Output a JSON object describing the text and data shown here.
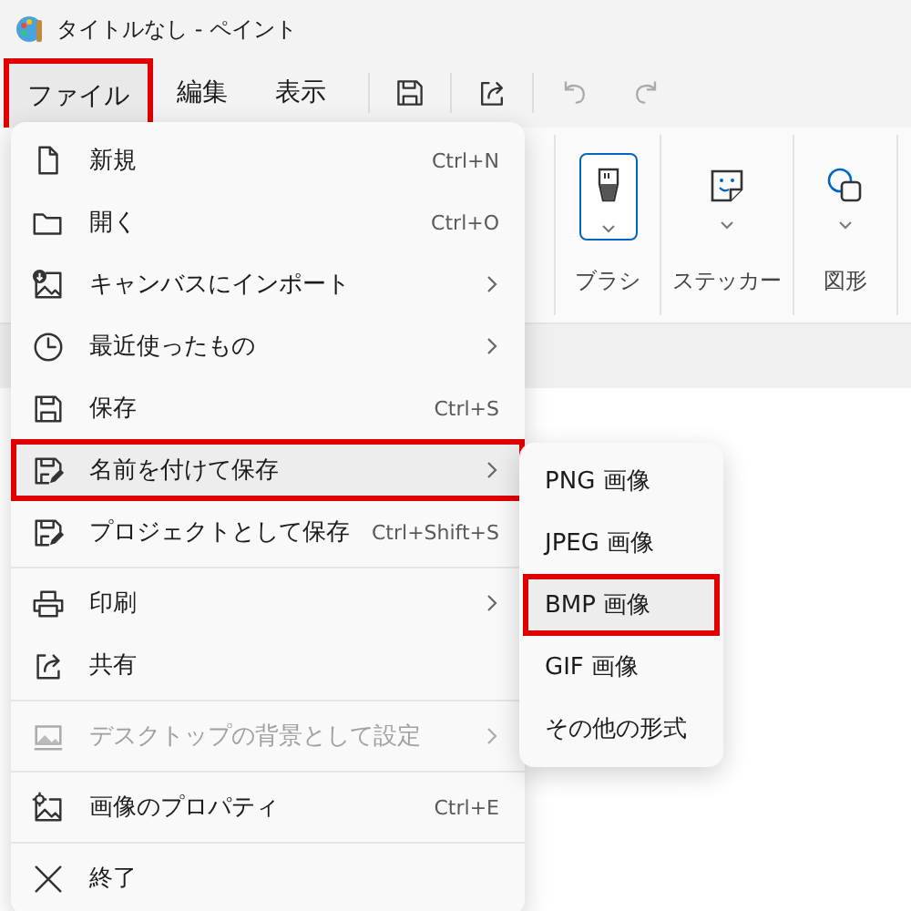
{
  "window": {
    "title": "タイトルなし - ペイント"
  },
  "menu_bar": [
    {
      "label": "ファイル",
      "selected": true
    },
    {
      "label": "編集",
      "selected": false
    },
    {
      "label": "表示",
      "selected": false
    }
  ],
  "ribbon": {
    "groups": [
      {
        "label": "ブラシ",
        "selected": true
      },
      {
        "label": "ステッカー",
        "selected": false
      },
      {
        "label": "図形",
        "selected": false
      }
    ]
  },
  "file_menu": {
    "items": [
      {
        "kind": "item",
        "label": "新規",
        "shortcut": "Ctrl+N",
        "submenu": false,
        "disabled": false,
        "selected": false
      },
      {
        "kind": "item",
        "label": "開く",
        "shortcut": "Ctrl+O",
        "submenu": false,
        "disabled": false,
        "selected": false
      },
      {
        "kind": "item",
        "label": "キャンバスにインポート",
        "submenu": true,
        "disabled": false,
        "selected": false
      },
      {
        "kind": "item",
        "label": "最近使ったもの",
        "submenu": true,
        "disabled": false,
        "selected": false
      },
      {
        "kind": "item",
        "label": "保存",
        "shortcut": "Ctrl+S",
        "submenu": false,
        "disabled": false,
        "selected": false
      },
      {
        "kind": "item",
        "label": "名前を付けて保存",
        "submenu": true,
        "disabled": false,
        "selected": true
      },
      {
        "kind": "item",
        "label": "プロジェクトとして保存",
        "shortcut": "Ctrl+Shift+S",
        "submenu": false,
        "disabled": false,
        "selected": false
      },
      {
        "kind": "separator"
      },
      {
        "kind": "item",
        "label": "印刷",
        "submenu": true,
        "disabled": false,
        "selected": false
      },
      {
        "kind": "item",
        "label": "共有",
        "submenu": false,
        "disabled": false,
        "selected": false
      },
      {
        "kind": "separator"
      },
      {
        "kind": "item",
        "label": "デスクトップの背景として設定",
        "submenu": true,
        "disabled": true,
        "selected": false
      },
      {
        "kind": "separator"
      },
      {
        "kind": "item",
        "label": "画像のプロパティ",
        "shortcut": "Ctrl+E",
        "submenu": false,
        "disabled": false,
        "selected": false
      },
      {
        "kind": "separator"
      },
      {
        "kind": "item",
        "label": "終了",
        "submenu": false,
        "disabled": false,
        "selected": false
      }
    ]
  },
  "save_as_menu": {
    "items": [
      {
        "label": "PNG 画像",
        "selected": false
      },
      {
        "label": "JPEG 画像",
        "selected": false
      },
      {
        "label": "BMP 画像",
        "selected": true
      },
      {
        "label": "GIF 画像",
        "selected": false
      },
      {
        "label": "その他の形式",
        "selected": false
      }
    ]
  }
}
